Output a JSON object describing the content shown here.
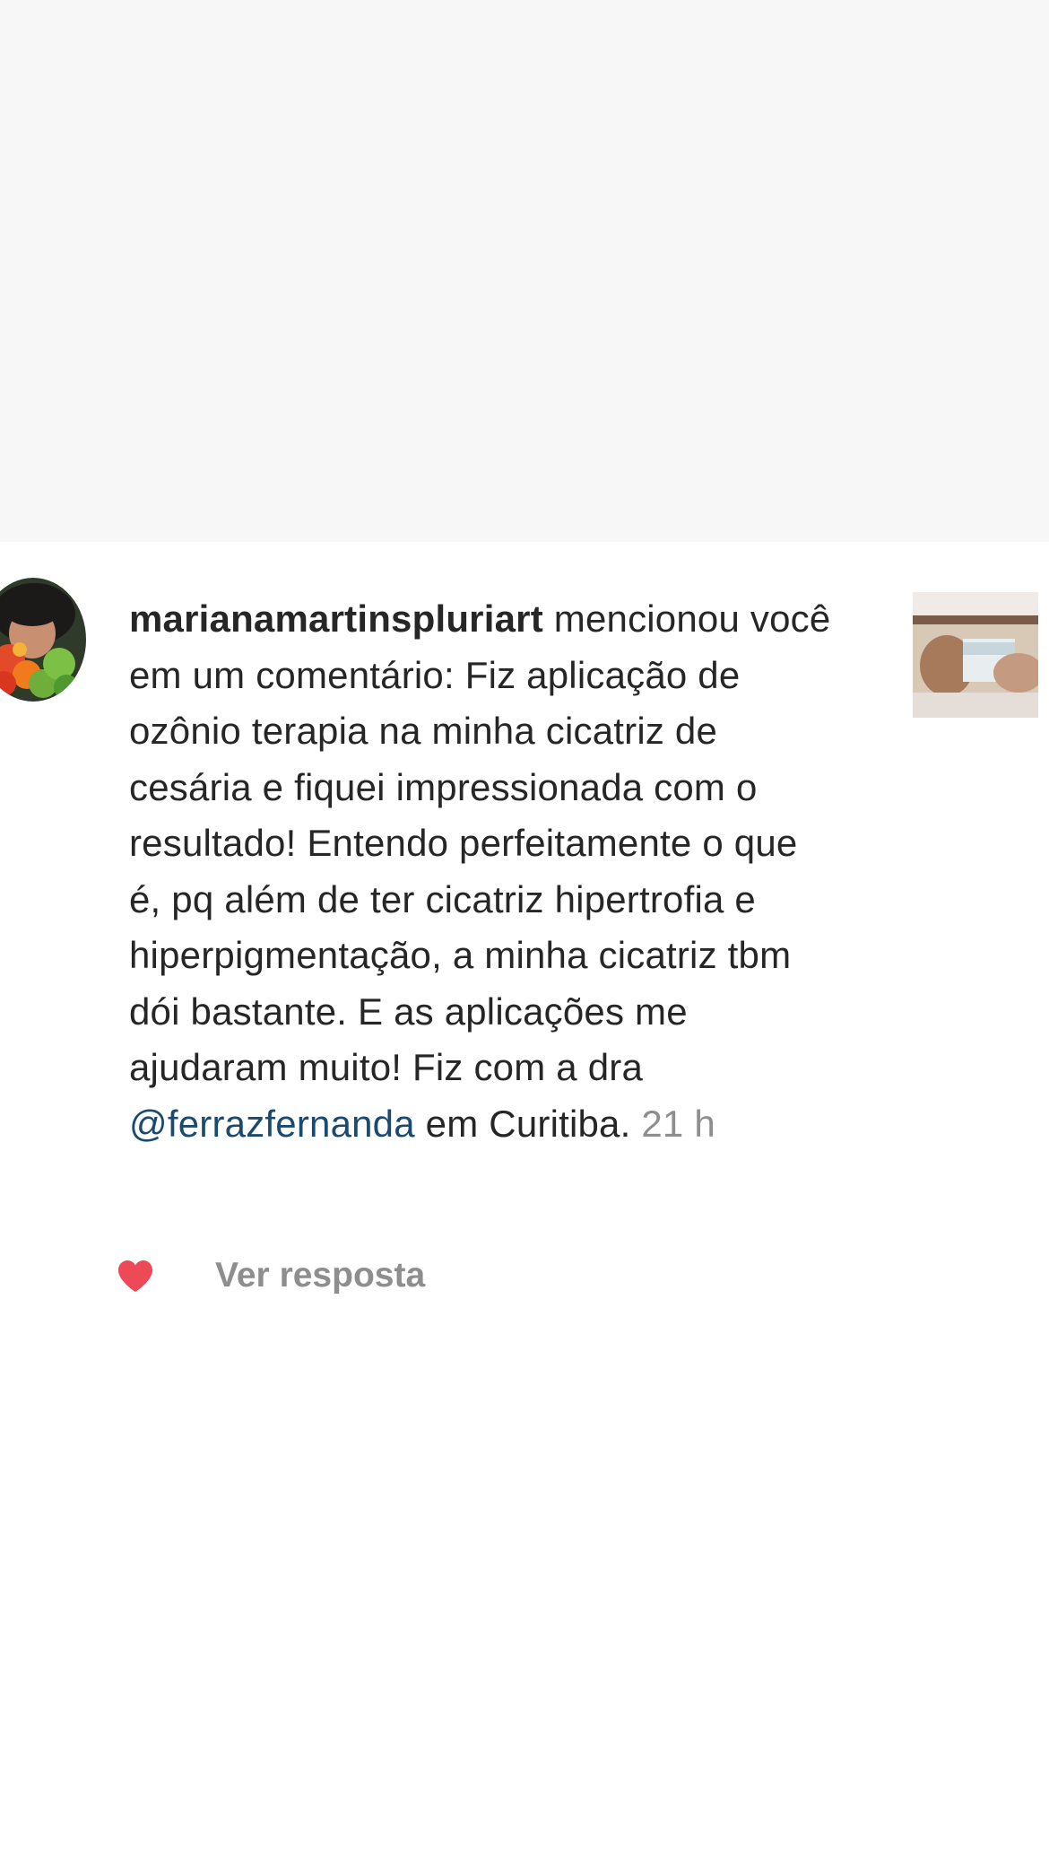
{
  "notification": {
    "username": "marianamartinspluriart",
    "action_text": " mencionou você em um comentário: Fiz aplicação de ozônio terapia na minha cicatriz de cesária e fiquei impressionada com o resultado! Entendo perfeitamente o que é, pq além de ter cicatriz hipertrofia e hiperpigmentação, a minha cicatriz tbm dói bastante. E as aplicações me ajudaram muito! Fiz com a dra ",
    "mention": "@ferrazfernanda",
    "after_mention": " em Curitiba.",
    "timestamp": " 21 h",
    "avatar_icon": "user-avatar",
    "thumbnail_icon": "post-thumbnail"
  },
  "actions": {
    "like_icon": "heart-icon",
    "like_color": "#ed4956",
    "reply_label": "Ver resposta"
  },
  "colors": {
    "text": "#262626",
    "muted": "#8e8e8e",
    "mention": "#1b4a6f",
    "top_band": "#f7f7f7"
  }
}
